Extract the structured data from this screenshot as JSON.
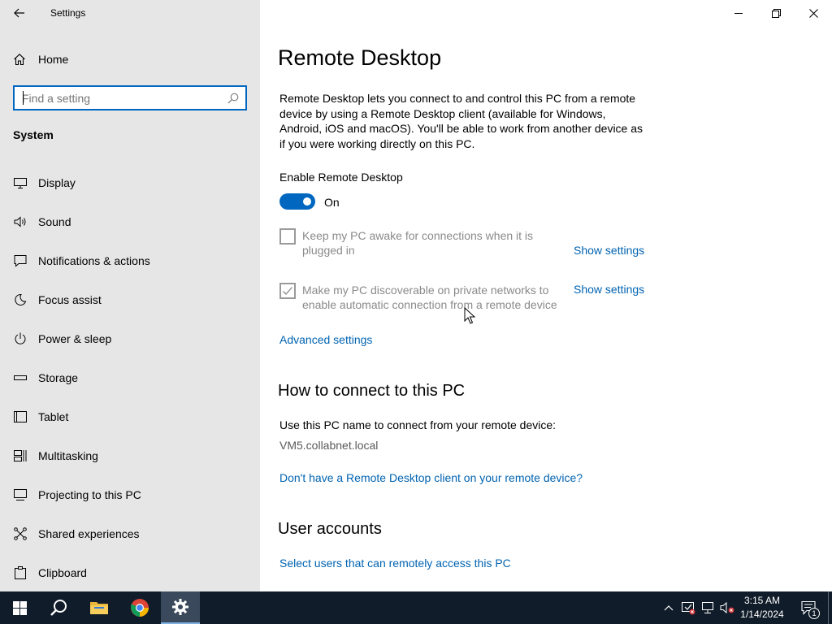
{
  "window": {
    "title": "Settings"
  },
  "sidebar": {
    "home_label": "Home",
    "search_placeholder": "Find a setting",
    "section_label": "System",
    "items": [
      {
        "label": "Display",
        "icon": "display-icon"
      },
      {
        "label": "Sound",
        "icon": "sound-icon"
      },
      {
        "label": "Notifications & actions",
        "icon": "notifications-icon"
      },
      {
        "label": "Focus assist",
        "icon": "moon-icon"
      },
      {
        "label": "Power & sleep",
        "icon": "power-icon"
      },
      {
        "label": "Storage",
        "icon": "storage-icon"
      },
      {
        "label": "Tablet",
        "icon": "tablet-icon"
      },
      {
        "label": "Multitasking",
        "icon": "multitasking-icon"
      },
      {
        "label": "Projecting to this PC",
        "icon": "projecting-icon"
      },
      {
        "label": "Shared experiences",
        "icon": "shared-experiences-icon"
      },
      {
        "label": "Clipboard",
        "icon": "clipboard-icon"
      }
    ]
  },
  "main": {
    "title": "Remote Desktop",
    "description": "Remote Desktop lets you connect to and control this PC from a remote device by using a Remote Desktop client (available for Windows, Android, iOS and macOS). You'll be able to work from another device as if you were working directly on this PC.",
    "enable_label": "Enable Remote Desktop",
    "toggle_state": "On",
    "toggle_on": true,
    "keep_awake": {
      "label": "Keep my PC awake for connections when it is plugged in",
      "checked": false,
      "link": "Show settings"
    },
    "discoverable": {
      "label": "Make my PC discoverable on private networks to enable automatic connection from a remote device",
      "checked": true,
      "link": "Show settings"
    },
    "advanced_link": "Advanced settings",
    "connect_heading": "How to connect to this PC",
    "connect_text": "Use this PC name to connect from your remote device:",
    "pc_name": "VM5.collabnet.local",
    "no_client_link": "Don't have a Remote Desktop client on your remote device?",
    "user_accounts_heading": "User accounts",
    "select_users_link": "Select users that can remotely access this PC"
  },
  "taskbar": {
    "time": "3:15 AM",
    "date": "1/14/2024",
    "notification_count": "1",
    "accent": "#0067c0"
  }
}
